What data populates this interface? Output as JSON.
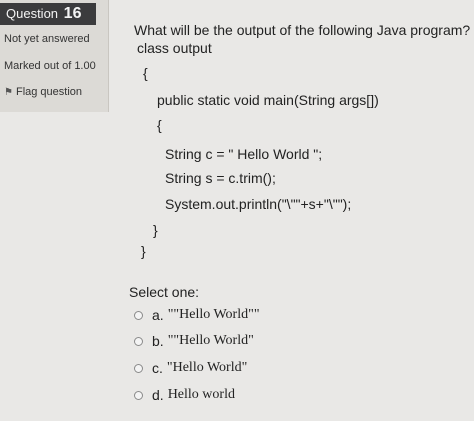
{
  "info": {
    "question_label": "Question",
    "question_number": "16",
    "status": "Not yet answered",
    "marks": "Marked out of 1.00",
    "flag_label": "Flag question"
  },
  "question": {
    "prompt": "What will be the output of the following Java program?",
    "code_lines": [
      "class output",
      "{",
      "public static void main(String args[])",
      "{",
      "String c = \" Hello World \";",
      "String s = c.trim();",
      "System.out.println(\"\\\"\"+s+\"\\\"\");",
      "}",
      "}"
    ]
  },
  "answers": {
    "select_label": "Select one:",
    "options": [
      {
        "letter": "a.",
        "text": "\"\"Hello World\"\""
      },
      {
        "letter": "b.",
        "text": "\"\"Hello World\""
      },
      {
        "letter": "c.",
        "text": "\"Hello World\""
      },
      {
        "letter": "d.",
        "text": "Hello world"
      }
    ]
  }
}
